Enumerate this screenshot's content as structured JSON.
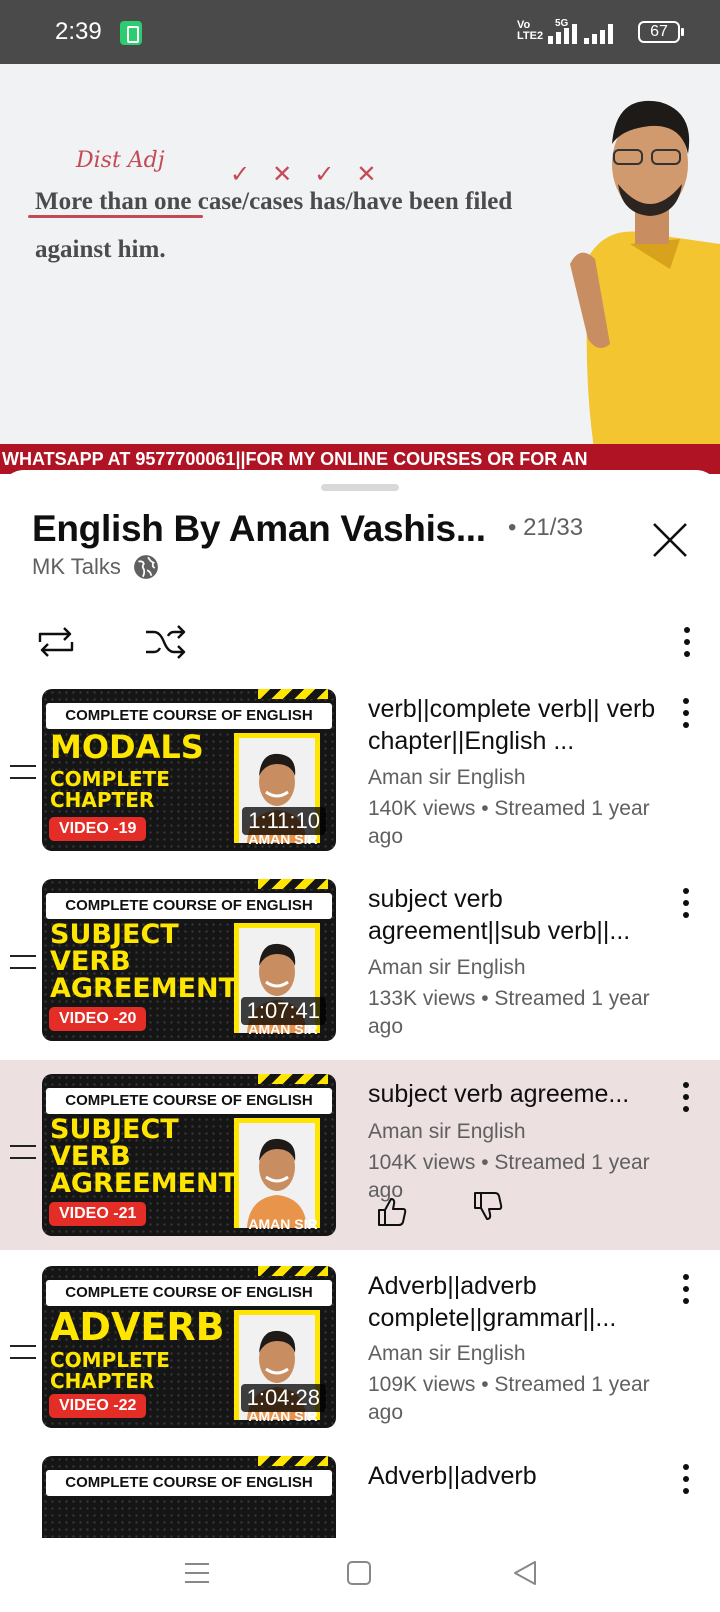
{
  "status_bar": {
    "time": "2:39",
    "network": "VoLTE2",
    "network_line1": "Vo",
    "network_line2": "LTE2",
    "five_g": "5G",
    "battery": "67"
  },
  "video": {
    "handwritten_note": "Dist Adj",
    "board_line_1": "More than one case/cases has/have been filed",
    "board_line_2": "against him.",
    "ticker": "WHATSAPP AT 9577700061||FOR MY ONLINE COURSES OR FOR AN"
  },
  "playlist": {
    "title": "English By Aman Vashis...",
    "position": "• 21/33",
    "channel": "MK Talks"
  },
  "items": [
    {
      "thumb_header": "COMPLETE COURSE OF ENGLISH",
      "thumb_title": "MODALS",
      "thumb_sub": "COMPLETE\nCHAPTER",
      "badge": "VIDEO -19",
      "photo_name": "AMAN SIR",
      "duration": "1:11:10",
      "title": "verb||complete verb|| verb chapter||English ...",
      "channel": "Aman sir English",
      "stats": "140K views • Streamed 1 year ago"
    },
    {
      "thumb_header": "COMPLETE COURSE OF ENGLISH",
      "thumb_title": "SUBJECT\nVERB\nAGREEMENT",
      "thumb_sub": "",
      "badge": "VIDEO -20",
      "photo_name": "AMAN SIR",
      "duration": "1:07:41",
      "title": "subject verb agreement||sub verb||...",
      "channel": "Aman sir English",
      "stats": "133K views • Streamed 1 year ago"
    },
    {
      "thumb_header": "COMPLETE COURSE OF ENGLISH",
      "thumb_title": "SUBJECT\nVERB\nAGREEMENT",
      "thumb_sub": "",
      "badge": "VIDEO -21",
      "photo_name": "AMAN SIR",
      "duration": "",
      "title": "subject verb agreeme...",
      "channel": "Aman sir English",
      "stats": "104K views • Streamed 1 year ago"
    },
    {
      "thumb_header": "COMPLETE COURSE OF ENGLISH",
      "thumb_title": "ADVERB",
      "thumb_sub": "COMPLETE\nCHAPTER",
      "badge": "VIDEO -22",
      "photo_name": "AMAN SIR",
      "duration": "1:04:28",
      "title": "Adverb||adverb complete||grammar||...",
      "channel": "Aman sir English",
      "stats": "109K views • Streamed 1 year ago"
    },
    {
      "thumb_header": "COMPLETE COURSE OF ENGLISH",
      "title": "Adverb||adverb"
    }
  ],
  "icons": {
    "close": "close-icon",
    "loop": "repeat-icon",
    "shuffle": "shuffle-icon",
    "more": "more-vert-icon",
    "like": "thumbs-up-icon",
    "dislike": "thumbs-down-icon",
    "globe": "globe-icon"
  },
  "colors": {
    "active_row": "#ece0e1",
    "ticker": "#b01323",
    "thumb_accent": "#ffe600",
    "badge": "#e52d27"
  }
}
